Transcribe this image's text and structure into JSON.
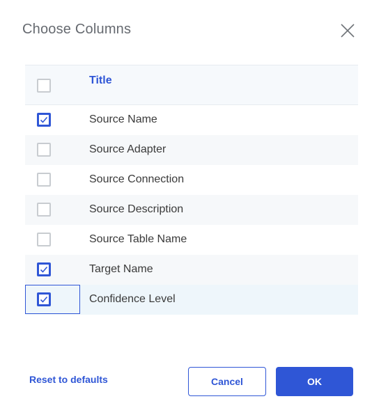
{
  "dialog": {
    "title": "Choose Columns",
    "close_icon": "close-icon"
  },
  "table": {
    "header": {
      "title": "Title",
      "checked": false
    },
    "rows": [
      {
        "label": "Source Name",
        "checked": true
      },
      {
        "label": "Source Adapter",
        "checked": false
      },
      {
        "label": "Source Connection",
        "checked": false
      },
      {
        "label": "Source Description",
        "checked": false
      },
      {
        "label": "Source Table Name",
        "checked": false
      },
      {
        "label": "Target Name",
        "checked": true
      },
      {
        "label": "Confidence Level",
        "checked": true,
        "focused": true
      }
    ]
  },
  "footer": {
    "reset_label": "Reset to defaults",
    "cancel_label": "Cancel",
    "ok_label": "OK"
  },
  "colors": {
    "accent": "#2f56d6",
    "title_text": "#666a70",
    "row_alt": "#f6f8fa",
    "row_focused": "#eef6fb"
  }
}
